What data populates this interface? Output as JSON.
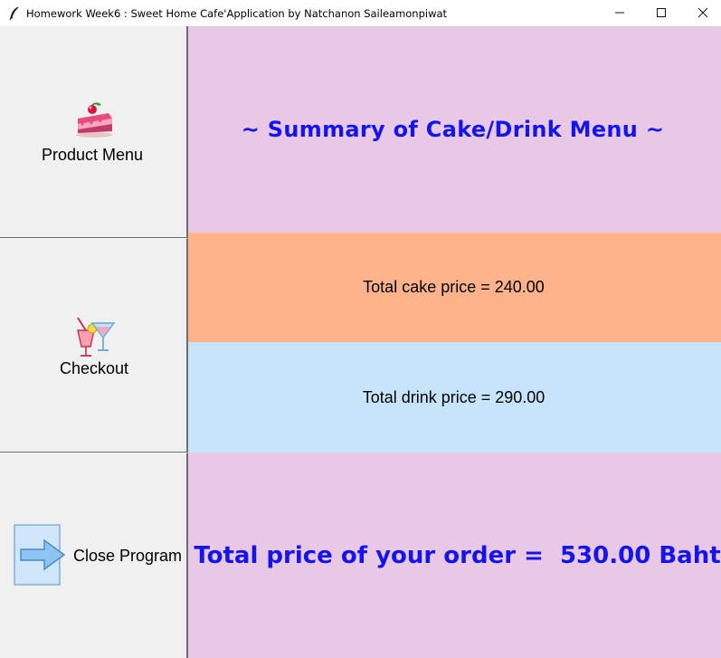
{
  "window": {
    "title": "Homework Week6 : Sweet Home Cafe'Application by Natchanon Saileamonpiwat",
    "app_icon": "feather-icon",
    "controls": {
      "minimize": "minimize-icon",
      "maximize": "maximize-icon",
      "close": "close-icon"
    }
  },
  "sidebar": {
    "product_menu": {
      "label": "Product Menu",
      "icon": "cake-icon"
    },
    "checkout": {
      "label": "Checkout",
      "icon": "cocktail-icon"
    },
    "close_program": {
      "label": "Close Program",
      "icon": "arrow-right-icon"
    }
  },
  "main": {
    "heading": "~ Summary of Cake/Drink Menu ~",
    "cake_total": "Total cake price = 240.00",
    "drink_total": "Total drink price = 290.00",
    "order_total": "Total price of your order =  530.00 Baht"
  },
  "colors": {
    "title_panel_bg": "#e9c8e6",
    "cake_panel_bg": "#ffb38b",
    "drink_panel_bg": "#c6e5fc",
    "accent_text": "#1414f0"
  }
}
